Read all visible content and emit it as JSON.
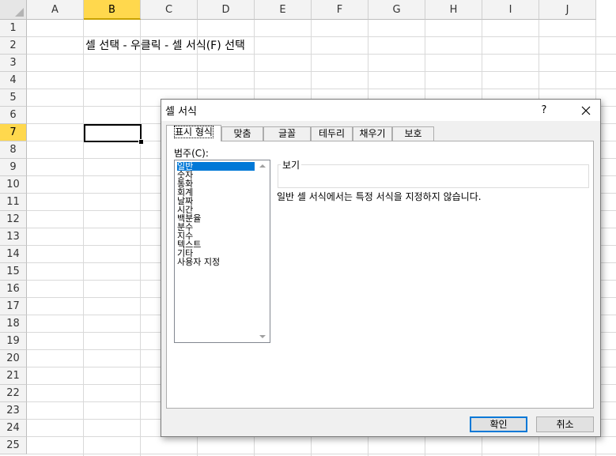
{
  "sheet": {
    "columns": [
      "A",
      "B",
      "C",
      "D",
      "E",
      "F",
      "G",
      "H",
      "I",
      "J"
    ],
    "selected_column": "B",
    "rows": [
      "1",
      "2",
      "3",
      "4",
      "5",
      "6",
      "7",
      "8",
      "9",
      "10",
      "11",
      "12",
      "13",
      "14",
      "15",
      "16",
      "17",
      "18",
      "19",
      "20",
      "21",
      "22",
      "23",
      "24",
      "25"
    ],
    "selected_row": "7",
    "cell_b2_text": "셀 선택 - 우클릭 - 셀 서식(F) 선택"
  },
  "dialog": {
    "title": "셀 서식",
    "help_label": "?",
    "tabs": [
      {
        "label": "표시 형식",
        "active": true
      },
      {
        "label": "맞춤",
        "active": false
      },
      {
        "label": "글꼴",
        "active": false
      },
      {
        "label": "테두리",
        "active": false
      },
      {
        "label": "채우기",
        "active": false
      },
      {
        "label": "보호",
        "active": false
      }
    ],
    "category_label": "범주(C):",
    "categories": [
      "일반",
      "숫자",
      "통화",
      "회계",
      "날짜",
      "시간",
      "백분율",
      "분수",
      "지수",
      "텍스트",
      "기타",
      "사용자 지정"
    ],
    "selected_category": "일반",
    "sample_label": "보기",
    "sample_value": "",
    "description": "일반 셀 서식에서는 특정 서식을 지정하지 않습니다.",
    "ok_label": "확인",
    "cancel_label": "취소"
  },
  "colors": {
    "selection_header": "#ffd84d",
    "list_selection": "#0078d7",
    "default_button_border": "#0078d7"
  }
}
